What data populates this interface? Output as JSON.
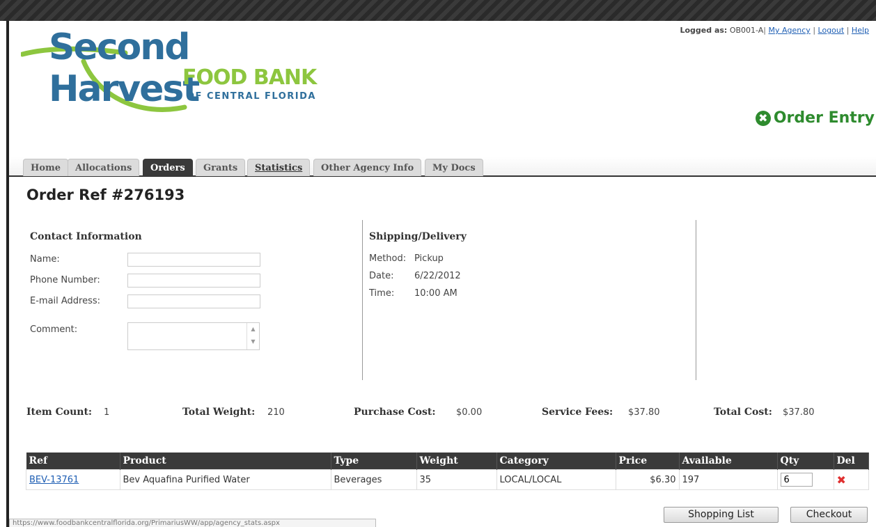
{
  "header": {
    "logo": {
      "line1": "Second Harvest",
      "line2": "FOOD BANK",
      "line3": "OF CENTRAL FLORIDA"
    },
    "user": {
      "logged_label": "Logged as:",
      "user_id": "OB001-A",
      "links": [
        "My Agency",
        "Logout",
        "Help"
      ]
    },
    "page_label": "Order Entry"
  },
  "tabs": [
    {
      "label": "Home"
    },
    {
      "label": "Allocations"
    },
    {
      "label": "Orders",
      "active": true
    },
    {
      "label": "Grants"
    },
    {
      "label": "Statistics"
    },
    {
      "label": "Other Agency Info"
    },
    {
      "label": "My Docs"
    }
  ],
  "order": {
    "ref_title": "Order Ref #276193",
    "contact": {
      "title": "Contact Information",
      "name_label": "Name:",
      "phone_label": "Phone Number:",
      "email_label": "E-mail Address:",
      "comment_label": "Comment:",
      "name_value": "",
      "phone_value": "",
      "email_value": "",
      "comment_value": ""
    },
    "shipping": {
      "title": "Shipping/Delivery",
      "method_label": "Method:",
      "method_value": "Pickup",
      "date_label": "Date:",
      "date_value": "6/22/2012",
      "time_label": "Time:",
      "time_value": "10:00 AM"
    },
    "summary": {
      "item_count_label": "Item Count:",
      "item_count": "1",
      "total_weight_label": "Total Weight:",
      "total_weight": "210",
      "purchase_cost_label": "Purchase Cost:",
      "purchase_cost": "$0.00",
      "service_fees_label": "Service Fees:",
      "service_fees": "$37.80",
      "total_cost_label": "Total Cost:",
      "total_cost": "$37.80"
    },
    "table": {
      "columns": [
        "Ref",
        "Product",
        "Type",
        "Weight",
        "Category",
        "Price",
        "Available",
        "Qty",
        "Del"
      ],
      "rows": [
        {
          "ref": "BEV-13761",
          "product": "Bev Aquafina Purified Water",
          "type": "Beverages",
          "weight": "35",
          "category": "LOCAL/LOCAL",
          "price": "$6.30",
          "available": "197",
          "qty": "6"
        }
      ]
    },
    "buttons": {
      "shopping_list": "Shopping List",
      "checkout": "Checkout"
    }
  },
  "statusbar": {
    "url": "https://www.foodbankcentralflorida.org/PrimariusWW/app/agency_stats.aspx"
  },
  "colors": {
    "link": "#1f5fb4",
    "accent_green": "#2e8b2e",
    "logo_blue": "#2f6f9c",
    "logo_green": "#8dc63f",
    "tab_active": "#3a3a3a"
  }
}
